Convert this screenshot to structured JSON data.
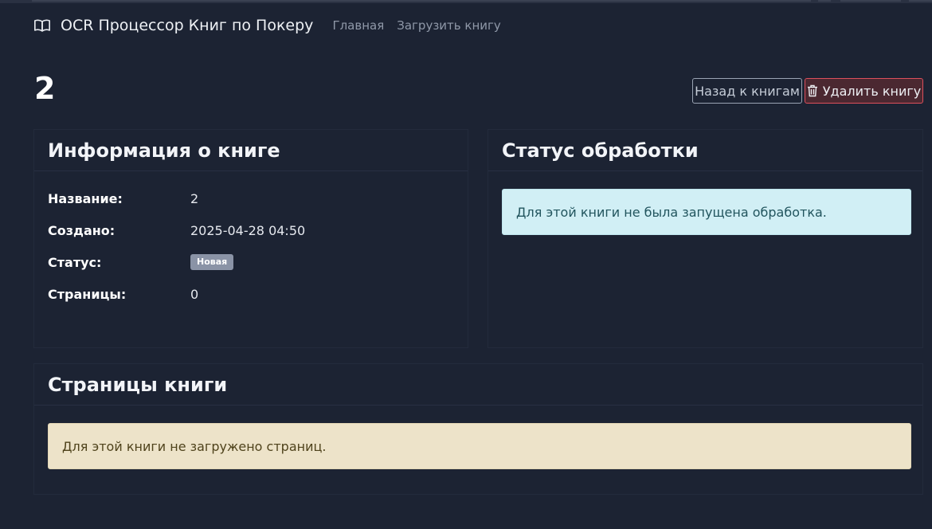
{
  "navbar": {
    "icon": "book-open-icon",
    "brand": "OCR Процессор Книг по Покеру",
    "links": [
      "Главная",
      "Загрузить книгу"
    ]
  },
  "page": {
    "title": "2",
    "back_button": "Назад к книгам",
    "delete_button": "Удалить книгу",
    "delete_icon": "trash-icon"
  },
  "info_card": {
    "title": "Информация о книге",
    "rows": [
      {
        "label": "Название:",
        "value": "2"
      },
      {
        "label": "Создано:",
        "value": "2025-04-28 04:50"
      },
      {
        "label": "Статус:",
        "value": "Новая"
      },
      {
        "label": "Страницы:",
        "value": "0"
      }
    ]
  },
  "status_card": {
    "title": "Статус обработки",
    "message": "Для этой книги не была запущена обработка."
  },
  "pages_card": {
    "title": "Страницы книги",
    "message": "Для этой книги не загружено страниц."
  },
  "colors": {
    "background": "#1c2333",
    "info_alert": "#d1eff5",
    "warning_alert": "#ede3c9",
    "danger": "#dc4f5c",
    "badge": "#8a93a6"
  }
}
